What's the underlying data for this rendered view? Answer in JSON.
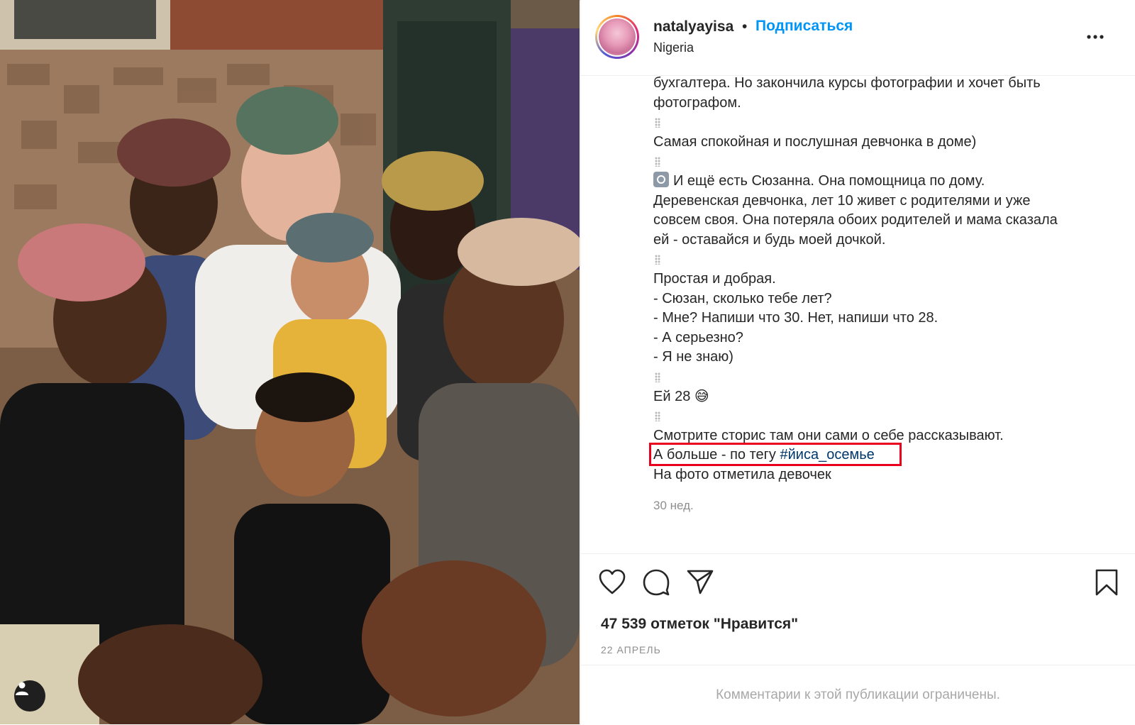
{
  "post": {
    "username": "natalyayisa",
    "separator": "•",
    "follow_label": "Подписаться",
    "location": "Nigeria"
  },
  "caption": {
    "line1": "бухгалтера. Но закончила курсы фотографии и хочет быть",
    "line2": "фотографом.",
    "line3": "Самая спокойная и послушная девчонка в доме)",
    "line4": "И ещё есть Сюзанна. Она помощница по дому.",
    "line5": "Деревенская девчонка, лет 10 живет с родителями и уже",
    "line6": "совсем своя. Она потеряла обоих родителей и мама сказала",
    "line7": "ей - оставайся и будь моей дочкой.",
    "line8": "Простая и добрая.",
    "line9": "- Сюзан, сколько тебе лет?",
    "line10": "- Мне? Напиши что 30. Нет, напиши что 28.",
    "line11": "- А серьезно?",
    "line12": "- Я не знаю)",
    "line13": "Ей 28 😅",
    "line14": "Смотрите сторис там они сами о себе рассказывают.",
    "line15_prefix": "А больше - по тегу ",
    "hashtag": "#йиса_осемье",
    "line16": "На фото отметила девочек"
  },
  "time_ago": "30 нед.",
  "likes_text": "47 539 отметок \"Нравится\"",
  "date_text": "22 АПРЕЛЬ",
  "comments_notice": "Комментарии к этой публикации ограничены.",
  "icons": {
    "like": "heart-icon",
    "comment": "comment-bubble-icon",
    "share": "paper-plane-icon",
    "save": "bookmark-icon",
    "more": "more-dots-icon",
    "tags": "person-icon"
  },
  "colors": {
    "accent": "#0095f6",
    "hashtag": "#00376b",
    "highlight": "#e8001c",
    "muted": "#8e8e8e"
  }
}
